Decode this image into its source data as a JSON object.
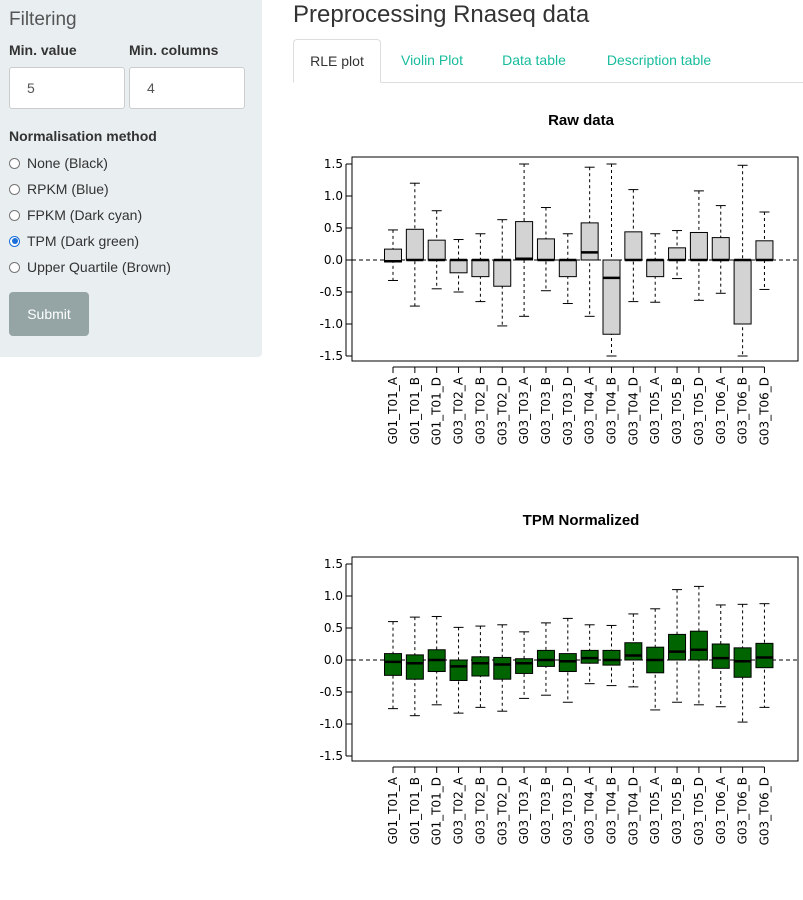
{
  "sidebar": {
    "title": "Filtering",
    "min_value_label": "Min. value",
    "min_value": "5",
    "min_columns_label": "Min. columns",
    "min_columns": "4",
    "method_label": "Normalisation method",
    "methods": [
      "None (Black)",
      "RPKM (Blue)",
      "FPKM (Dark cyan)",
      "TPM (Dark green)",
      "Upper Quartile (Brown)"
    ],
    "selected_method": 3,
    "submit_label": "Submit"
  },
  "main": {
    "title": "Preprocessing Rnaseq data",
    "tabs": [
      "RLE plot",
      "Violin Plot",
      "Data table",
      "Description table"
    ],
    "active_tab": 0
  },
  "colors": {
    "accent": "#18bc9c",
    "raw_box": "#d3d3d3",
    "tpm_box": "#006400",
    "radio": "#1a6fd8"
  },
  "chart_data": [
    {
      "type": "box",
      "title": "Raw data",
      "ylim": [
        -1.5,
        1.5
      ],
      "yticks": [
        "1.5",
        "1.0",
        "0.5",
        "0.0",
        "-0.5",
        "-1.0",
        "-1.5"
      ],
      "hline": 0.0,
      "categories": [
        "G01_T01_A",
        "G01_T01_B",
        "G01_T01_D",
        "G03_T02_A",
        "G03_T02_B",
        "G03_T02_D",
        "G03_T03_A",
        "G03_T03_B",
        "G03_T03_D",
        "G03_T04_A",
        "G03_T04_B",
        "G03_T04_D",
        "G03_T05_A",
        "G03_T05_B",
        "G03_T05_D",
        "G03_T06_A",
        "G03_T06_B",
        "G03_T06_D"
      ],
      "boxes": [
        {
          "lo": -0.32,
          "q1": -0.03,
          "med": -0.02,
          "q3": 0.17,
          "hi": 0.47
        },
        {
          "lo": -0.72,
          "q1": 0.0,
          "med": 0.0,
          "q3": 0.48,
          "hi": 1.2
        },
        {
          "lo": -0.45,
          "q1": 0.0,
          "med": 0.0,
          "q3": 0.31,
          "hi": 0.77
        },
        {
          "lo": -0.5,
          "q1": -0.2,
          "med": 0.0,
          "q3": 0.0,
          "hi": 0.32
        },
        {
          "lo": -0.65,
          "q1": -0.26,
          "med": 0.0,
          "q3": 0.0,
          "hi": 0.41
        },
        {
          "lo": -1.03,
          "q1": -0.41,
          "med": 0.0,
          "q3": 0.0,
          "hi": 0.63
        },
        {
          "lo": -0.88,
          "q1": 0.0,
          "med": 0.02,
          "q3": 0.6,
          "hi": 1.5
        },
        {
          "lo": -0.48,
          "q1": 0.0,
          "med": 0.0,
          "q3": 0.33,
          "hi": 0.82
        },
        {
          "lo": -0.68,
          "q1": -0.26,
          "med": 0.0,
          "q3": 0.0,
          "hi": 0.41
        },
        {
          "lo": -0.88,
          "q1": 0.0,
          "med": 0.12,
          "q3": 0.58,
          "hi": 1.45
        },
        {
          "lo": -1.5,
          "q1": -1.16,
          "med": -0.28,
          "q3": 0.0,
          "hi": 1.5
        },
        {
          "lo": -0.65,
          "q1": 0.0,
          "med": 0.0,
          "q3": 0.44,
          "hi": 1.1
        },
        {
          "lo": -0.66,
          "q1": -0.26,
          "med": 0.0,
          "q3": 0.0,
          "hi": 0.41
        },
        {
          "lo": -0.29,
          "q1": 0.0,
          "med": 0.0,
          "q3": 0.19,
          "hi": 0.46
        },
        {
          "lo": -0.63,
          "q1": 0.0,
          "med": 0.0,
          "q3": 0.43,
          "hi": 1.08
        },
        {
          "lo": -0.52,
          "q1": 0.0,
          "med": 0.0,
          "q3": 0.35,
          "hi": 0.85
        },
        {
          "lo": -1.5,
          "q1": -1.0,
          "med": 0.0,
          "q3": 0.0,
          "hi": 1.48
        },
        {
          "lo": -0.46,
          "q1": 0.0,
          "med": 0.0,
          "q3": 0.3,
          "hi": 0.75
        }
      ]
    },
    {
      "type": "box",
      "title": "TPM Normalized",
      "ylim": [
        -1.5,
        1.5
      ],
      "yticks": [
        "1.5",
        "1.0",
        "0.5",
        "0.0",
        "-0.5",
        "-1.0",
        "-1.5"
      ],
      "hline": 0.0,
      "categories": [
        "G01_T01_A",
        "G01_T01_B",
        "G01_T01_D",
        "G03_T02_A",
        "G03_T02_B",
        "G03_T02_D",
        "G03_T03_A",
        "G03_T03_B",
        "G03_T03_D",
        "G03_T04_A",
        "G03_T04_B",
        "G03_T04_D",
        "G03_T05_A",
        "G03_T05_B",
        "G03_T05_D",
        "G03_T06_A",
        "G03_T06_B",
        "G03_T06_D"
      ],
      "boxes": [
        {
          "lo": -0.76,
          "q1": -0.24,
          "med": -0.03,
          "q3": 0.1,
          "hi": 0.6
        },
        {
          "lo": -0.87,
          "q1": -0.3,
          "med": -0.05,
          "q3": 0.08,
          "hi": 0.67
        },
        {
          "lo": -0.7,
          "q1": -0.18,
          "med": 0.0,
          "q3": 0.16,
          "hi": 0.68
        },
        {
          "lo": -0.83,
          "q1": -0.32,
          "med": -0.1,
          "q3": 0.0,
          "hi": 0.51
        },
        {
          "lo": -0.74,
          "q1": -0.25,
          "med": -0.05,
          "q3": 0.05,
          "hi": 0.53
        },
        {
          "lo": -0.8,
          "q1": -0.3,
          "med": -0.07,
          "q3": 0.04,
          "hi": 0.55
        },
        {
          "lo": -0.6,
          "q1": -0.21,
          "med": -0.05,
          "q3": 0.02,
          "hi": 0.44
        },
        {
          "lo": -0.55,
          "q1": -0.1,
          "med": 0.0,
          "q3": 0.15,
          "hi": 0.58
        },
        {
          "lo": -0.66,
          "q1": -0.18,
          "med": -0.02,
          "q3": 0.1,
          "hi": 0.65
        },
        {
          "lo": -0.37,
          "q1": -0.05,
          "med": 0.03,
          "q3": 0.15,
          "hi": 0.55
        },
        {
          "lo": -0.4,
          "q1": -0.08,
          "med": 0.0,
          "q3": 0.15,
          "hi": 0.54
        },
        {
          "lo": -0.42,
          "q1": 0.0,
          "med": 0.07,
          "q3": 0.27,
          "hi": 0.72
        },
        {
          "lo": -0.78,
          "q1": -0.2,
          "med": 0.0,
          "q3": 0.2,
          "hi": 0.8
        },
        {
          "lo": -0.66,
          "q1": 0.0,
          "med": 0.13,
          "q3": 0.4,
          "hi": 1.1
        },
        {
          "lo": -0.7,
          "q1": 0.0,
          "med": 0.16,
          "q3": 0.45,
          "hi": 1.15
        },
        {
          "lo": -0.73,
          "q1": -0.13,
          "med": 0.03,
          "q3": 0.25,
          "hi": 0.86
        },
        {
          "lo": -0.97,
          "q1": -0.27,
          "med": -0.02,
          "q3": 0.19,
          "hi": 0.87
        },
        {
          "lo": -0.74,
          "q1": -0.12,
          "med": 0.04,
          "q3": 0.26,
          "hi": 0.88
        }
      ]
    }
  ]
}
